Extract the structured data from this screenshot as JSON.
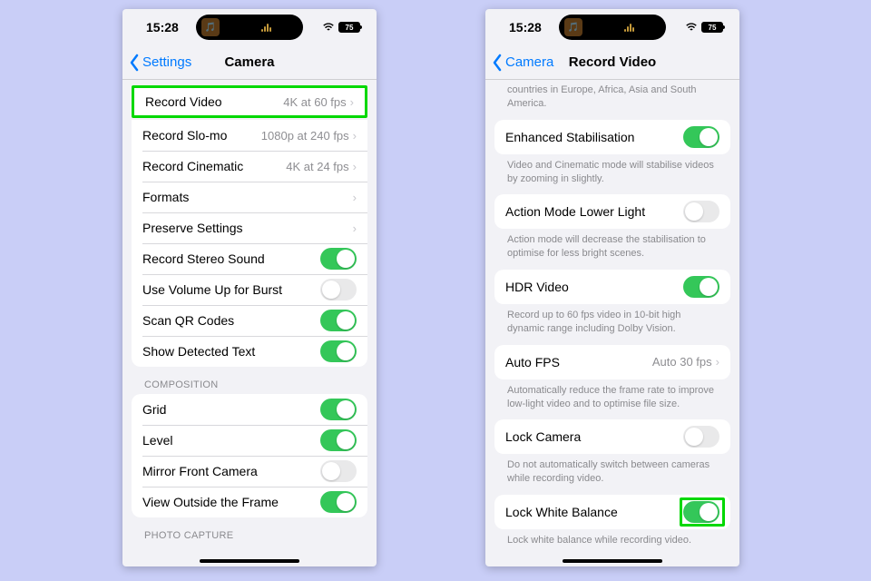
{
  "status": {
    "time": "15:28",
    "battery": "75"
  },
  "phone_a": {
    "back_label": "Settings",
    "title": "Camera",
    "rows": {
      "record_video": {
        "label": "Record Video",
        "value": "4K at 60 fps"
      },
      "record_slomo": {
        "label": "Record Slo-mo",
        "value": "1080p at 240 fps"
      },
      "record_cinematic": {
        "label": "Record Cinematic",
        "value": "4K at 24 fps"
      },
      "formats": {
        "label": "Formats"
      },
      "preserve": {
        "label": "Preserve Settings"
      },
      "stereo": {
        "label": "Record Stereo Sound"
      },
      "volume_burst": {
        "label": "Use Volume Up for Burst"
      },
      "scan_qr": {
        "label": "Scan QR Codes"
      },
      "detect_text": {
        "label": "Show Detected Text"
      }
    },
    "section_composition": "COMPOSITION",
    "comp": {
      "grid": "Grid",
      "level": "Level",
      "mirror": "Mirror Front Camera",
      "outside": "View Outside the Frame"
    },
    "section_photo_capture": "PHOTO CAPTURE"
  },
  "phone_b": {
    "back_label": "Camera",
    "title": "Record Video",
    "top_cut": "countries in Europe, Africa, Asia and South America.",
    "enhanced_stab": "Enhanced Stabilisation",
    "enhanced_stab_foot": "Video and Cinematic mode will stabilise videos by zooming in slightly.",
    "action_low": "Action Mode Lower Light",
    "action_low_foot": "Action mode will decrease the stabilisation to optimise for less bright scenes.",
    "hdr": "HDR Video",
    "hdr_foot": "Record up to 60 fps video in 10-bit high dynamic range including Dolby Vision.",
    "auto_fps": {
      "label": "Auto FPS",
      "value": "Auto 30 fps"
    },
    "auto_fps_foot": "Automatically reduce the frame rate to improve low-light video and to optimise file size.",
    "lock_camera": "Lock Camera",
    "lock_camera_foot": "Do not automatically switch between cameras while recording video.",
    "lock_wb": "Lock White Balance",
    "lock_wb_foot": "Lock white balance while recording video."
  }
}
